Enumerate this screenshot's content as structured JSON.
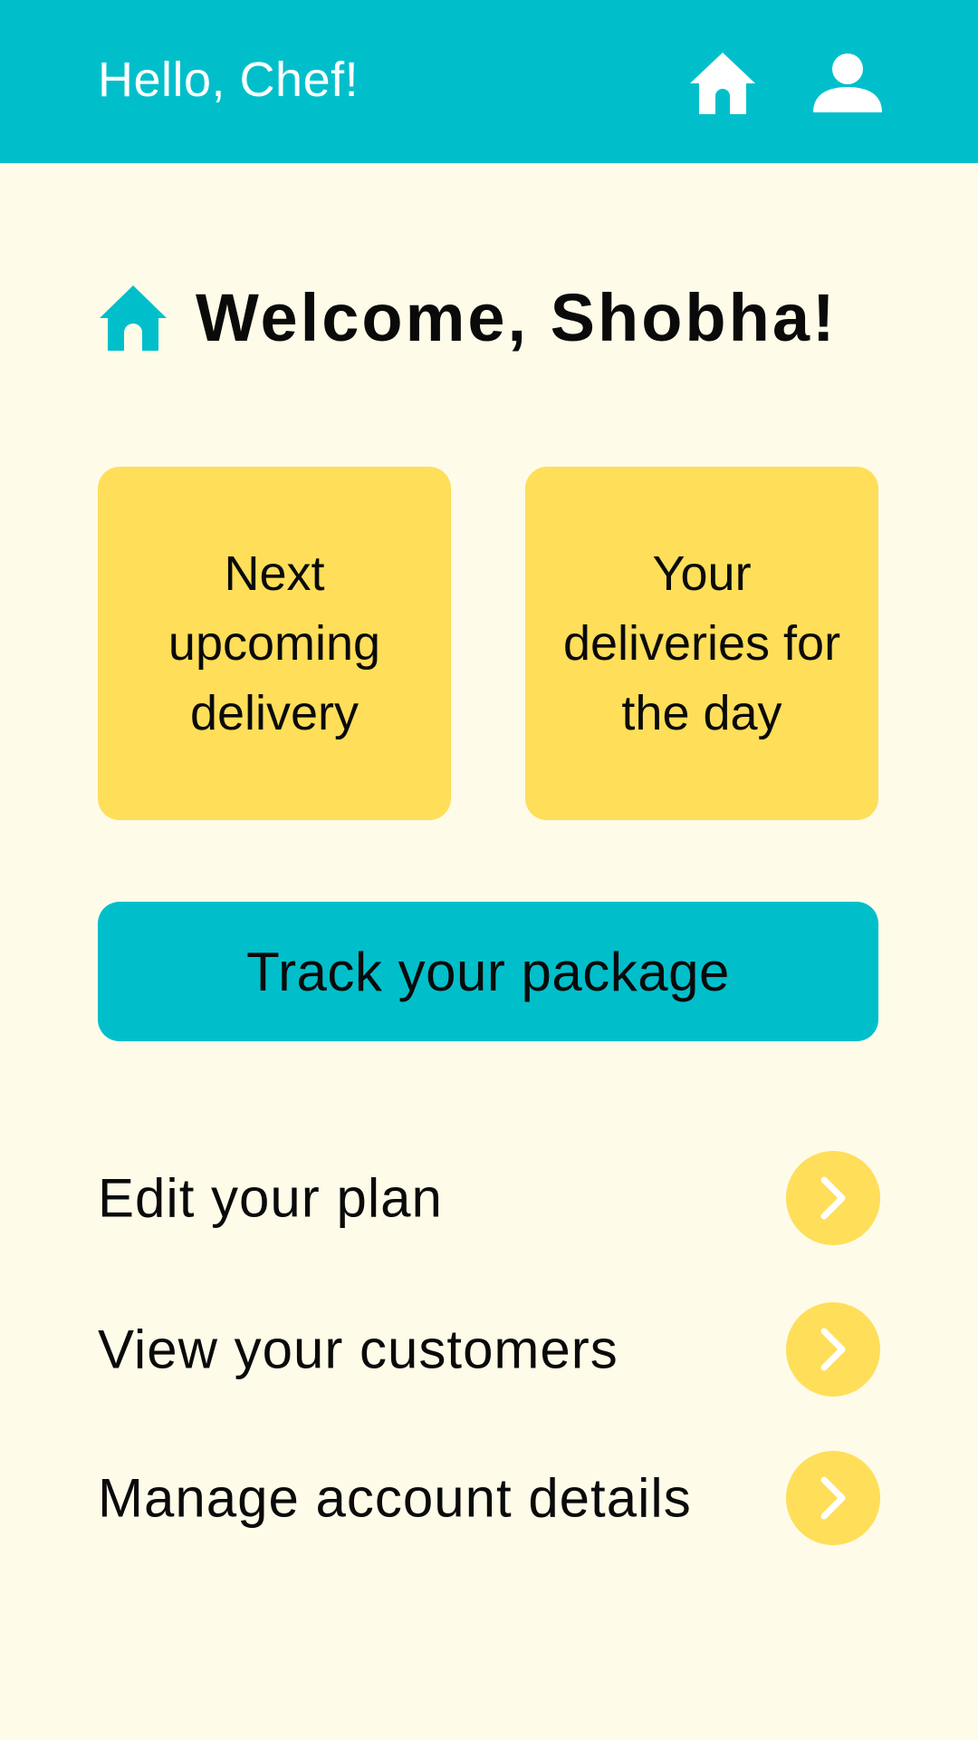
{
  "colors": {
    "background": "#FEFBE9",
    "primary": "#00BFCB",
    "accent": "#FFDE59",
    "text": "#0a0a0a",
    "header_text": "#ffffff"
  },
  "header": {
    "greeting": "Hello, Chef!",
    "icons": [
      "home-icon",
      "profile-icon"
    ]
  },
  "welcome": {
    "icon": "home-icon",
    "title": "Welcome, Shobha!"
  },
  "cards": [
    {
      "label": "Next upcoming delivery"
    },
    {
      "label": "Your deliveries for the day"
    }
  ],
  "track_button": {
    "label": "Track your package"
  },
  "menu": [
    {
      "label": "Edit your plan",
      "icon": "chevron-right-icon"
    },
    {
      "label": "View your customers",
      "icon": "chevron-right-icon"
    },
    {
      "label": "Manage account details",
      "icon": "chevron-right-icon"
    }
  ]
}
